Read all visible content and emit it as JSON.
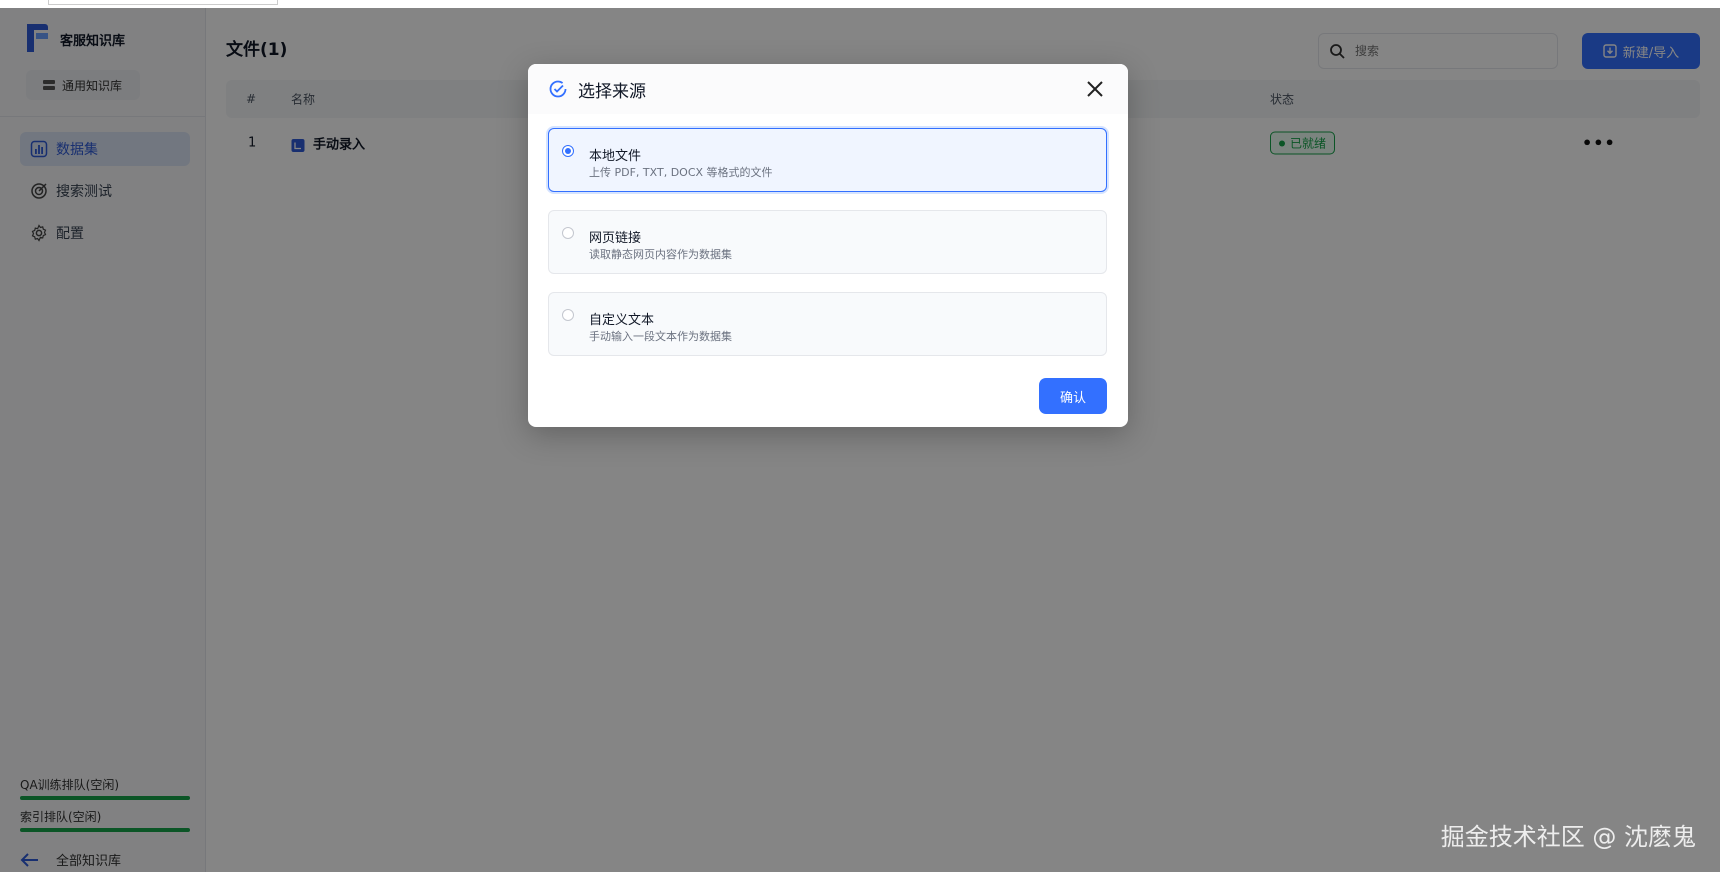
{
  "sidebar": {
    "kb_name": "客服知识库",
    "kb_type": "通用知识库",
    "nav": [
      {
        "label": "数据集",
        "active": true
      },
      {
        "label": "搜索测试",
        "active": false
      },
      {
        "label": "配置",
        "active": false
      }
    ],
    "queues": [
      {
        "label": "QA训练排队(空闲)",
        "progress": 1.0
      },
      {
        "label": "索引排队(空闲)",
        "progress": 1.0
      }
    ],
    "back_label": "全部知识库"
  },
  "main": {
    "title": "文件(1)",
    "search_placeholder": "搜索",
    "new_button": "新建/导入",
    "table": {
      "headers": [
        "#",
        "名称",
        "状态"
      ],
      "rows": [
        {
          "index": "1",
          "name": "手动录入",
          "status": "已就绪"
        }
      ]
    }
  },
  "modal": {
    "title": "选择来源",
    "options": [
      {
        "title": "本地文件",
        "desc": "上传 PDF, TXT, DOCX 等格式的文件",
        "selected": true
      },
      {
        "title": "网页链接",
        "desc": "读取静态网页内容作为数据集",
        "selected": false
      },
      {
        "title": "自定义文本",
        "desc": "手动输入一段文本作为数据集",
        "selected": false
      }
    ],
    "confirm": "确认"
  },
  "watermark": "掘金技术社区 @ 沈麽鬼",
  "colors": {
    "accent": "#3370ff",
    "success": "#16a34a"
  }
}
